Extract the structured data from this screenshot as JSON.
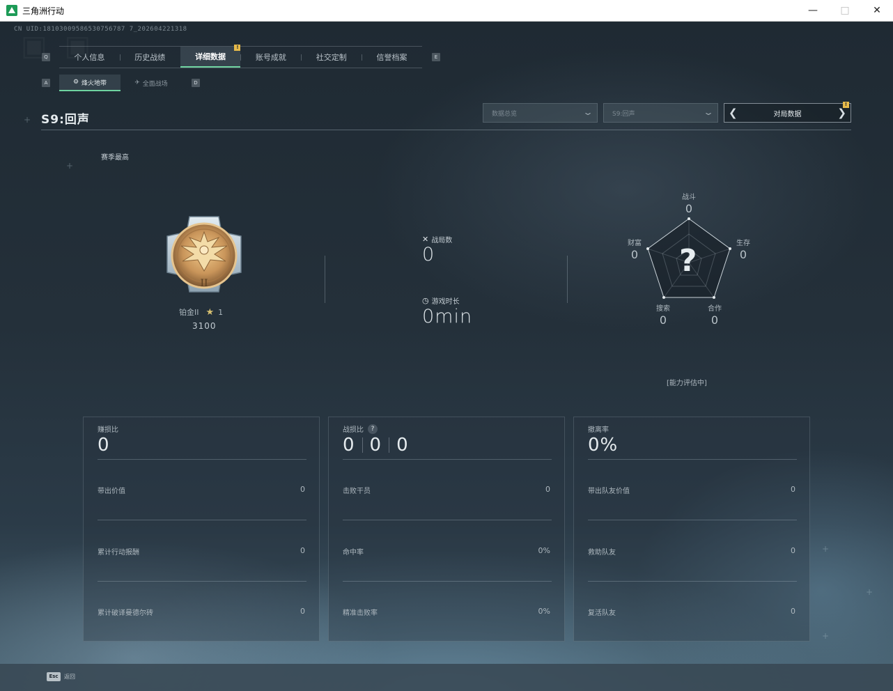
{
  "window": {
    "title": "三角洲行动"
  },
  "uid": "CN UID:18103009586530756787 7_202604221318",
  "tabs": {
    "items": [
      "个人信息",
      "历史战绩",
      "详细数据",
      "账号成就",
      "社交定制",
      "信誉档案"
    ],
    "active_index": 2,
    "notice": "!",
    "left_key": "Q",
    "right_key": "E"
  },
  "subtabs": {
    "items": [
      "烽火地带",
      "全面战场"
    ],
    "active_index": 0,
    "left_key": "A",
    "right_key": "D"
  },
  "season": {
    "title": "S9:回声"
  },
  "filters": {
    "data_type": "数据总览",
    "season": "S9:回声",
    "pager_label": "对局数据",
    "pager_notice": "!"
  },
  "rank": {
    "heading": "赛季最高",
    "tier": "铂金II",
    "stars": "1",
    "score": "3100"
  },
  "match": {
    "games_label": "战局数",
    "games_value": "0",
    "time_label": "游戏时长",
    "time_value": "0min"
  },
  "radar": {
    "center_mark": "?",
    "combat_label": "战斗",
    "combat_value": "0",
    "survival_label": "生存",
    "survival_value": "0",
    "teamwork_label": "合作",
    "teamwork_value": "0",
    "search_label": "搜索",
    "search_value": "0",
    "wealth_label": "财富",
    "wealth_value": "0",
    "status": "[能力评估中]"
  },
  "cards": [
    {
      "title": "赚损比",
      "big": [
        "0"
      ],
      "rows": [
        {
          "label": "带出价值",
          "value": "0"
        },
        {
          "label": "累计行动报酬",
          "value": "0"
        },
        {
          "label": "累计破译曼德尔砖",
          "value": "0"
        }
      ]
    },
    {
      "title": "战损比",
      "help": "?",
      "big": [
        "0",
        "0",
        "0"
      ],
      "rows": [
        {
          "label": "击败干员",
          "value": "0"
        },
        {
          "label": "命中率",
          "value": "0%"
        },
        {
          "label": "精准击败率",
          "value": "0%"
        }
      ]
    },
    {
      "title": "撤离率",
      "big": [
        "0%"
      ],
      "rows": [
        {
          "label": "带出队友价值",
          "value": "0"
        },
        {
          "label": "救助队友",
          "value": "0"
        },
        {
          "label": "复活队友",
          "value": "0"
        }
      ]
    }
  ],
  "footer": {
    "esc_key": "Esc",
    "esc_label": "返回"
  },
  "colors": {
    "accent": "#6fd3a0",
    "notice": "#e5b94a",
    "medal_gold": "#c9955a"
  },
  "icons": [
    "app-icon",
    "minimize-icon",
    "maximize-icon",
    "close-icon",
    "swords-icon",
    "clock-icon",
    "chevron-down-icon",
    "chevron-left-icon",
    "chevron-right-icon",
    "star-icon",
    "help-icon"
  ]
}
